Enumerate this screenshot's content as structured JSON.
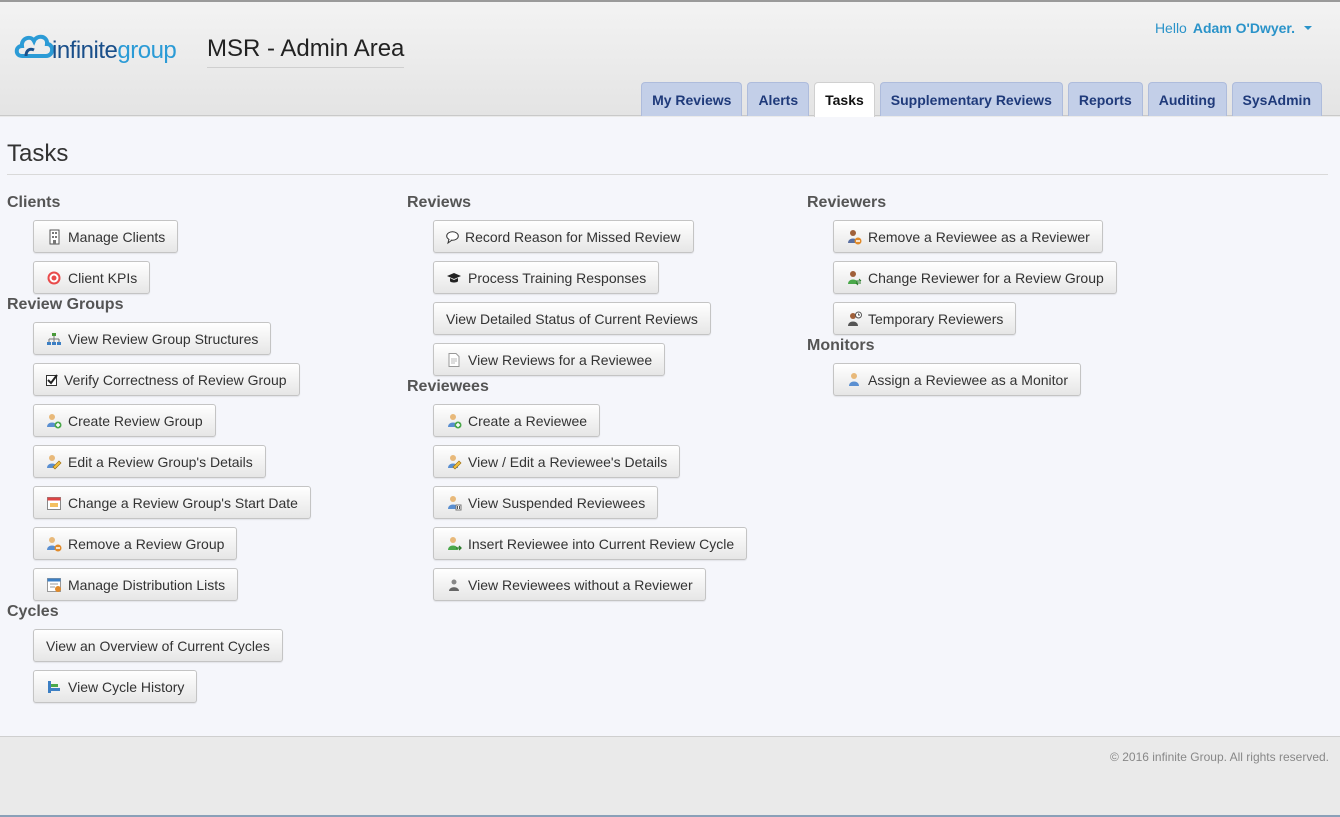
{
  "header": {
    "logo": {
      "text_part1": "infinite",
      "text_part2": "group"
    },
    "app_title": "MSR - Admin Area",
    "user": {
      "greeting": "Hello",
      "name": "Adam O'Dwyer."
    },
    "tabs": [
      {
        "label": "My Reviews",
        "active": false
      },
      {
        "label": "Alerts",
        "active": false
      },
      {
        "label": "Tasks",
        "active": true
      },
      {
        "label": "Supplementary Reviews",
        "active": false
      },
      {
        "label": "Reports",
        "active": false
      },
      {
        "label": "Auditing",
        "active": false
      },
      {
        "label": "SysAdmin",
        "active": false
      }
    ]
  },
  "page": {
    "title": "Tasks"
  },
  "sections": {
    "clients": {
      "title": "Clients",
      "items": [
        {
          "label": "Manage Clients",
          "icon": "building-icon"
        },
        {
          "label": "Client KPIs",
          "icon": "target-icon"
        }
      ]
    },
    "review_groups": {
      "title": "Review Groups",
      "items": [
        {
          "label": "View Review Group Structures",
          "icon": "org-chart-icon"
        },
        {
          "label": "Verify Correctness of Review Group",
          "icon": "checkbox-icon"
        },
        {
          "label": "Create Review Group",
          "icon": "group-add-icon"
        },
        {
          "label": "Edit a Review Group's Details",
          "icon": "group-edit-icon"
        },
        {
          "label": "Change a Review Group's Start Date",
          "icon": "calendar-icon"
        },
        {
          "label": "Remove a Review Group",
          "icon": "group-remove-icon"
        },
        {
          "label": "Manage Distribution Lists",
          "icon": "list-users-icon"
        }
      ]
    },
    "cycles": {
      "title": "Cycles",
      "items": [
        {
          "label": "View an Overview of Current Cycles",
          "icon": ""
        },
        {
          "label": "View Cycle History",
          "icon": "history-chart-icon"
        }
      ]
    },
    "reviews": {
      "title": "Reviews",
      "items": [
        {
          "label": "Record Reason for Missed Review",
          "icon": "comment-icon"
        },
        {
          "label": "Process Training Responses",
          "icon": "graduation-cap-icon"
        },
        {
          "label": "View Detailed Status of Current Reviews",
          "icon": ""
        },
        {
          "label": "View Reviews for a Reviewee",
          "icon": "document-icon"
        }
      ]
    },
    "reviewees": {
      "title": "Reviewees",
      "items": [
        {
          "label": "Create a Reviewee",
          "icon": "user-add-icon"
        },
        {
          "label": "View / Edit a Reviewee's Details",
          "icon": "user-edit-icon"
        },
        {
          "label": "View Suspended Reviewees",
          "icon": "user-suspended-icon"
        },
        {
          "label": "Insert Reviewee into Current Review Cycle",
          "icon": "user-insert-icon"
        },
        {
          "label": "View Reviewees without a Reviewer",
          "icon": "user-alone-icon"
        }
      ]
    },
    "reviewers": {
      "title": "Reviewers",
      "items": [
        {
          "label": "Remove a Reviewee as a Reviewer",
          "icon": "user-remove-icon"
        },
        {
          "label": "Change Reviewer for a Review Group",
          "icon": "user-change-icon"
        },
        {
          "label": "Temporary Reviewers",
          "icon": "user-clock-icon"
        }
      ]
    },
    "monitors": {
      "title": "Monitors",
      "items": [
        {
          "label": "Assign a Reviewee as a Monitor",
          "icon": "user-monitor-icon"
        }
      ]
    }
  },
  "footer": {
    "copyright": "© 2016 infinite Group. All rights reserved."
  },
  "colors": {
    "tab_bg": "#c3cfe8",
    "tab_text": "#1f3a7a",
    "link_blue": "#2a93c9"
  }
}
